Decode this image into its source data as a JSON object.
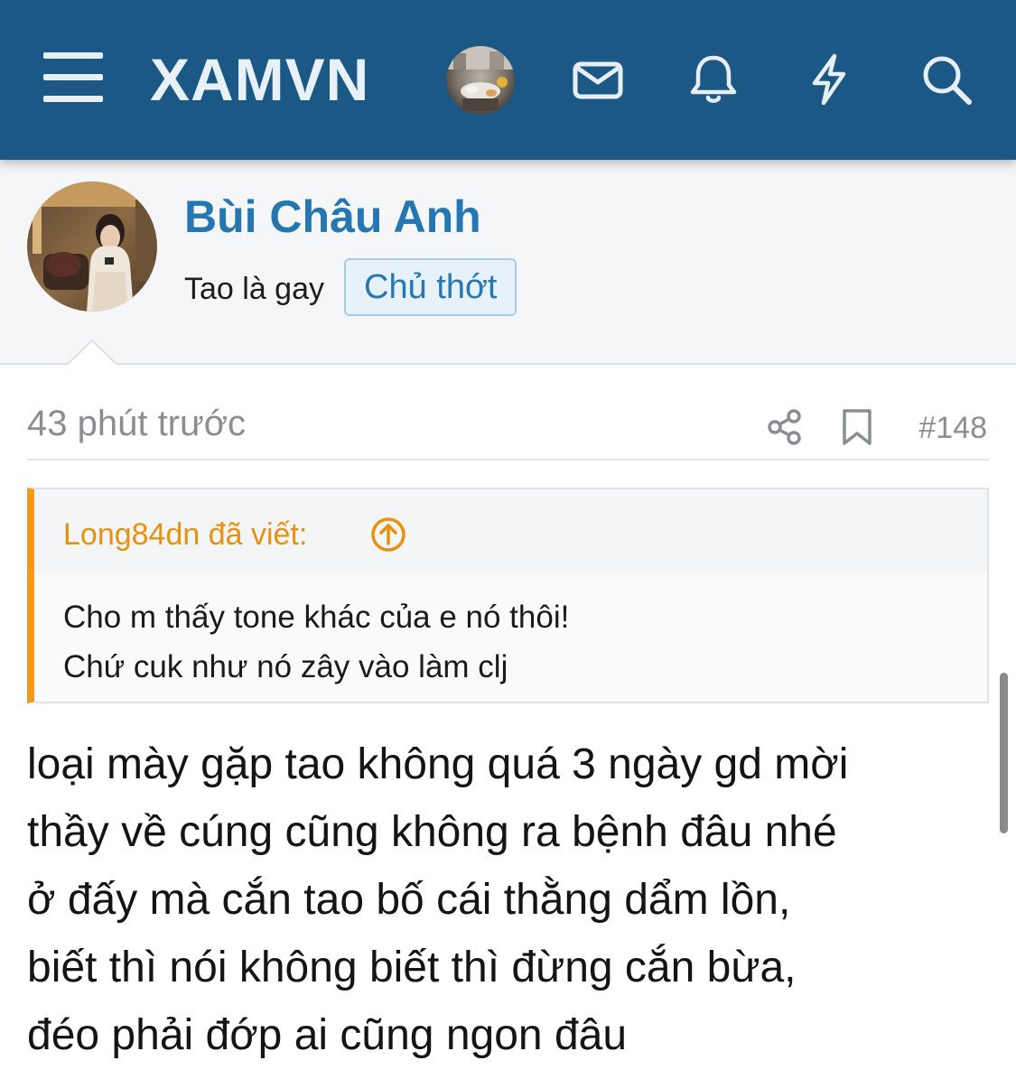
{
  "nav": {
    "logo": "XAMVN",
    "icons": [
      "menu-icon",
      "mail-icon",
      "bell-icon",
      "bolt-icon",
      "search-icon"
    ],
    "bar_color": "#1b5886"
  },
  "author": {
    "name": "Bùi Châu Anh",
    "title": "Tao là gay",
    "badge": "Chủ thớt"
  },
  "post": {
    "time": "43 phút trước",
    "number": "#148",
    "quote": {
      "author_label": "Long84dn đã viết:",
      "lines": [
        "Cho m thấy tone khác của e nó thôi!",
        "Chứ cuk như nó zây vào làm clj"
      ]
    },
    "body_lines": [
      "loại mày gặp tao không quá 3 ngày gd mời",
      "thầy về cúng cũng không ra bệnh đâu nhé",
      "ở đấy mà cắn tao bố cái thằng dẩm lồn,",
      "biết thì nói không biết thì đừng cắn bừa,",
      "đéo phải đớp ai cũng ngon đâu"
    ]
  },
  "colors": {
    "link": "#2577b1",
    "quote_accent": "#f39a1e",
    "muted": "#8a8d91"
  }
}
